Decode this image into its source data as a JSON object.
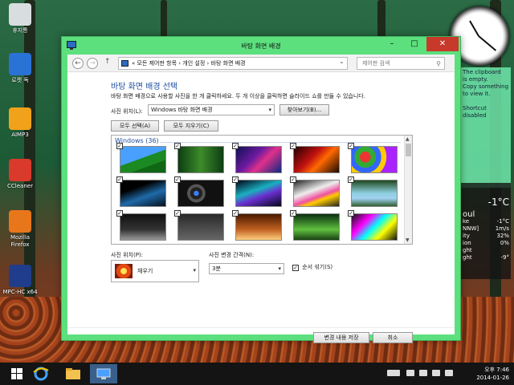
{
  "desktop": {
    "icons": [
      {
        "name": "recycle-bin",
        "label": "휴지통",
        "color": "#d8dde0"
      },
      {
        "name": "rocket-dock",
        "label": "로켓 독",
        "color": "#2a72d6"
      },
      {
        "name": "aimp3",
        "label": "AIMP3",
        "color": "#f0a21a"
      },
      {
        "name": "ccleaner",
        "label": "CCleaner",
        "color": "#d93a2b"
      },
      {
        "name": "firefox",
        "label": "Mozilla Firefox",
        "color": "#e8761a"
      },
      {
        "name": "mpc-hc",
        "label": "MPC-HC x64",
        "color": "#1f3d8a"
      }
    ],
    "side_panel": {
      "lines": [
        "The clipboard",
        "is empty.",
        "Copy something",
        "to view it.",
        "",
        "Shortcut",
        "disabled"
      ]
    },
    "weather": {
      "temp": "-1°C",
      "city": "oul",
      "details": [
        "-1°C",
        "1m/s",
        "32%",
        "0%",
        "",
        "-9°"
      ],
      "labels": [
        "ke",
        "NNW]",
        "ity",
        "ion",
        "ght",
        "ght"
      ]
    }
  },
  "window": {
    "title": "바탕 화면 배경",
    "controls": {
      "minimize": "–",
      "maximize": "□",
      "close": "✕"
    },
    "nav": {
      "back": "←",
      "forward": "→",
      "up": "↑"
    },
    "address": {
      "crumbs": "«  모든 제어판 항목  ›  개인 설정  ›  바탕 화면 배경",
      "dropdown": "⌄",
      "refresh": "⟳"
    },
    "search": {
      "placeholder": "제어판 검색",
      "icon": "⚲"
    },
    "heading": "바탕 화면 배경 선택",
    "description": "바탕 화면 배경으로 사용할 사진을 한 개 클릭하세요. 두 개 이상을 클릭하면 슬라이드 쇼를 만들 수 있습니다.",
    "picture_location": {
      "label": "사진 위치(L):",
      "value": "Windows 바탕 화면 배경",
      "browse": "찾아보기(B)..."
    },
    "select_all": "모두 선택(A)",
    "clear_all": "모두 지우기(C)",
    "gallery": {
      "group_title": "Windows (36)",
      "checkmark": "✓",
      "thumbs": [
        {
          "bg": "linear-gradient(160deg,#4aa0ff 0 45%,#1b8a22 46% 70%,#0f6615 71%)"
        },
        {
          "bg": "linear-gradient(90deg,#0d3d12,#3c8c2a,#0e3d12)"
        },
        {
          "bg": "linear-gradient(135deg,#101050,#6a1aa0 40%,#e0308a 60%,#0a2a80)"
        },
        {
          "bg": "linear-gradient(135deg,#200,#c01010 40%,#ff6a00 60%,#1a0a00)"
        },
        {
          "bg": "radial-gradient(circle at 30% 40%,#e33 0 15%,#3a3 16% 30%,#36f 31% 45%,#fc0 46% 60%,#a2f 61%)"
        },
        {
          "bg": "linear-gradient(160deg,#000 30%,#1f6aa8 60%,#05121e)"
        },
        {
          "bg": "radial-gradient(circle at 40% 50%,#3a7fff 0 8%,#222 9% 20%,#555 21% 30%,#111 31%)"
        },
        {
          "bg": "linear-gradient(160deg,#020214,#1ab0c0 40%,#6a30d0 60%,#05051a)"
        },
        {
          "bg": "linear-gradient(160deg,#222,#eee 40%,#f050a0 60%,#fc0 70%,#222)"
        },
        {
          "bg": "linear-gradient(180deg,#204820,#8fd0e0 50%,#a0d0f0 70%,#306030)"
        },
        {
          "bg": "linear-gradient(180deg,#111,#333 60%,#999)"
        },
        {
          "bg": "linear-gradient(180deg,#2a2a2a,#666)"
        },
        {
          "bg": "linear-gradient(180deg,#4a1a00,#c06020 60%,#ffd080)"
        },
        {
          "bg": "linear-gradient(180deg,#0a3010,#60c040 60%,#1a4010)"
        },
        {
          "bg": "linear-gradient(135deg,#111,#f0f 30%,#0ff 50%,#ff0 70%,#111)"
        }
      ]
    },
    "picture_position": {
      "label": "사진 위치(P):",
      "value": "채우기"
    },
    "interval": {
      "label": "사진 변경 간격(N):",
      "value": "3분"
    },
    "shuffle": {
      "label": "순서 섞기(S)",
      "checked": "✓"
    },
    "save": "변경 내용 저장",
    "cancel": "취소"
  },
  "taskbar": {
    "time": "오후 7:46",
    "date": "2014-01-26",
    "colors": {
      "bar": "#141414",
      "accent": "#2d6cc0"
    }
  }
}
